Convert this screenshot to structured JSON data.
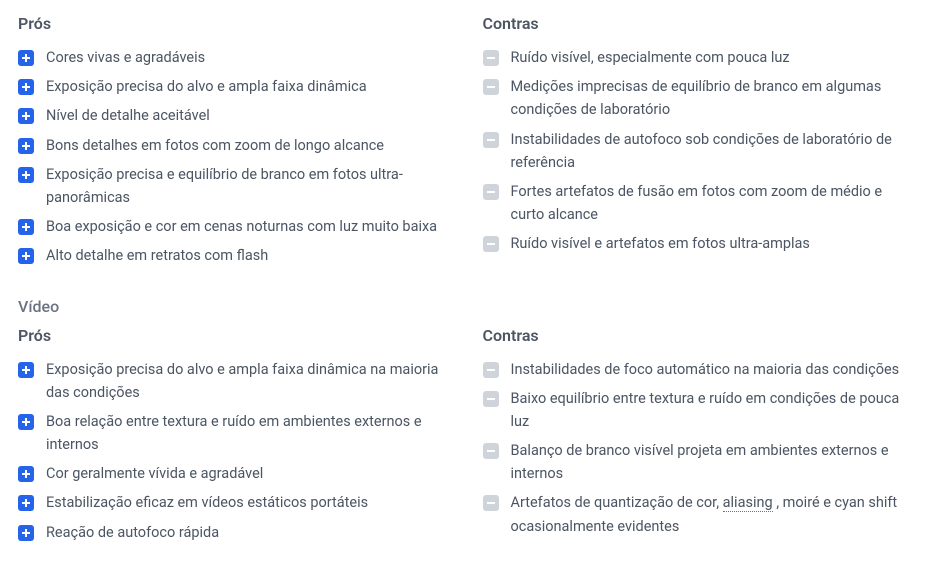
{
  "photo": {
    "pros": {
      "heading": "Prós",
      "items": [
        "Cores vivas e agradáveis",
        "Exposição precisa do alvo e ampla faixa dinâmica",
        "Nível de detalhe aceitável",
        "Bons detalhes em fotos com zoom de longo alcance",
        "Exposição precisa e equilíbrio de branco em fotos ultra-panorâmicas",
        "Boa exposição e cor em cenas noturnas com luz muito baixa",
        "Alto detalhe em retratos com flash"
      ]
    },
    "cons": {
      "heading": "Contras",
      "items": [
        "Ruído visível, especialmente com pouca luz",
        "Medições imprecisas de equilíbrio de branco em algumas condições de laboratório",
        "Instabilidades de autofoco sob condições de laboratório de referência",
        "Fortes artefatos de fusão em fotos com zoom de médio e curto alcance",
        "Ruído visível e artefatos em fotos ultra-amplas"
      ]
    }
  },
  "video": {
    "section_heading": "Vídeo",
    "pros": {
      "heading": "Prós",
      "items": [
        "Exposição precisa do alvo e ampla faixa dinâmica na maioria das condições",
        "Boa relação entre textura e ruído em ambientes externos e internos",
        "Cor geralmente vívida e agradável",
        "Estabilização eficaz em vídeos estáticos portáteis",
        "Reação de autofoco rápida"
      ]
    },
    "cons": {
      "heading": "Contras",
      "items": [
        "Instabilidades de foco automático na maioria das condições",
        "Baixo equilíbrio entre textura e ruído em condições de pouca luz",
        "Balanço de branco visível projeta em ambientes externos e internos",
        {
          "prefix": "Artefatos de quantização de cor, ",
          "link": "aliasing",
          "suffix": " , moiré e cyan shift ocasionalmente evidentes"
        }
      ]
    }
  }
}
